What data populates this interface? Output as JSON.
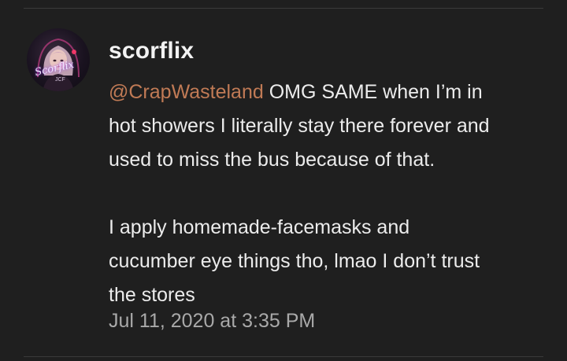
{
  "comment": {
    "author": "scorflix",
    "avatar_text": "Scorflix",
    "avatar_subtext": "JCF",
    "mention": "@CrapWasteland",
    "paragraph1": {
      "line1_rest": " OMG SAME when I’m in",
      "line2": "hot showers I literally stay there forever and",
      "line3": "used to miss the bus because of that."
    },
    "paragraph2": {
      "line1": "I apply homemade-facemasks and",
      "line2": "cucumber eye things tho, lmao I don’t trust",
      "line3": "the stores"
    },
    "timestamp": "Jul 11, 2020 at 3:35 PM"
  },
  "colors": {
    "background": "#1f1f1f",
    "text": "#ececec",
    "mention": "#c07a55",
    "timestamp": "#a9a9a9"
  }
}
